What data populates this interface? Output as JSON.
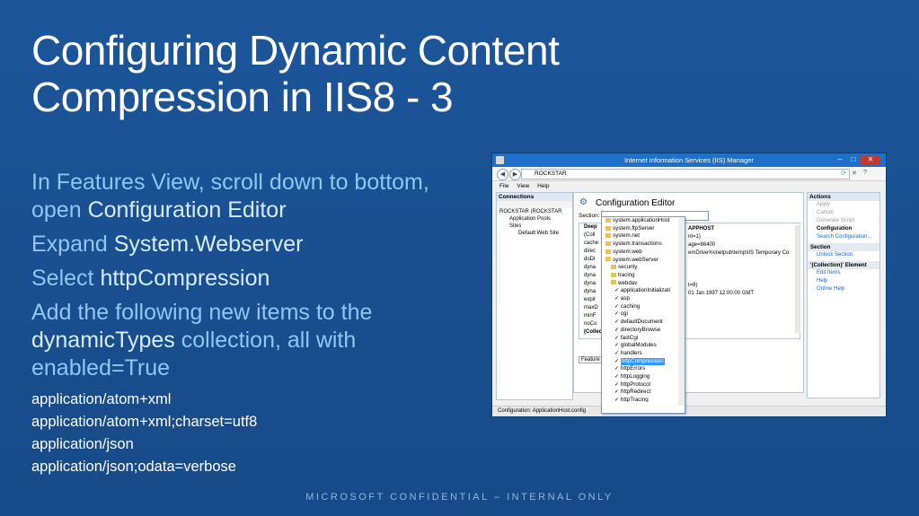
{
  "slide": {
    "title_line1": "Configuring Dynamic Content",
    "title_line2": "Compression in IIS8 - 3",
    "b1_a": "In Features View, scroll down to bottom, open ",
    "b1_hl": "Configuration Editor",
    "b2_a": "Expand ",
    "b2_hl": "System.Webserver",
    "b3_a": "Select ",
    "b3_hl": "httpCompression",
    "b4_a": "Add the following new items to the ",
    "b4_hl": "dynamicTypes",
    "b4_b": " collection, all with enabled=True",
    "code": [
      "application/atom+xml",
      "application/atom+xml;charset=utf8",
      "application/json",
      "application/json;odata=verbose"
    ],
    "footer": "MICROSOFT CONFIDENTIAL – INTERNAL ONLY"
  },
  "iis": {
    "window_title": "Internet Information Services (IIS) Manager",
    "address": "ROCKSTAR",
    "menu": [
      "File",
      "View",
      "Help"
    ],
    "connections_header": "Connections",
    "tree": [
      "ROCKSTAR (ROCKSTAR",
      "Application Pools",
      "Sites",
      "Default Web Site"
    ],
    "editor_title": "Configuration Editor",
    "section_label": "Section:",
    "grid_rows": [
      "Deep",
      "(Coll",
      "cache",
      "direc",
      "doDi",
      "dyna",
      "dyna",
      "dyna",
      "dyna",
      "expir",
      "maxD",
      "minF",
      "noCo",
      "(Collec"
    ],
    "grid_right": [
      "APPHOST",
      "nt=1)",
      "age=86400",
      "emDrive%\\inetpub\\temp\\IIS Temporary Co",
      "",
      "",
      "",
      "t=8)",
      "01 Jan 1997 12:00:00 GMT"
    ],
    "dropdown": [
      "system.applicationHost",
      "system.ftpServer",
      "system.net",
      "system.transactions",
      "system.web",
      "system.webServer",
      "security",
      "tracing",
      "webdav",
      "applicationInitializati",
      "asp",
      "caching",
      "cgi",
      "defaultDocument",
      "directoryBrowse",
      "fastCgi",
      "globalModules",
      "handlers",
      "httpCompression",
      "httpErrors",
      "httpLogging",
      "httpProtocol",
      "httpRedirect",
      "httpTracing"
    ],
    "features_tab": "Feature",
    "actions_header": "Actions",
    "actions": [
      "Apply",
      "Cancel",
      "Generate Script",
      "Configuration",
      "Search Configuration...",
      "Section",
      "Unlock Section",
      "'(Collection)' Element",
      "Edit Items",
      "Help",
      "Online Help"
    ],
    "status": "Configuration: ApplicationHost.config"
  }
}
